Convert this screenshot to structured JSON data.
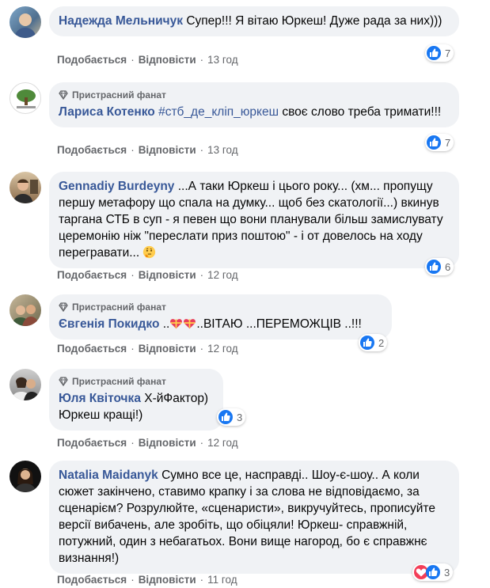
{
  "ui": {
    "like": "Подобається",
    "reply": "Відповісти",
    "fan_badge": "Пристрасний фанат",
    "sep": "·"
  },
  "comments": [
    {
      "author": "Надежда Мельничук",
      "text": "Супер!!! Я вітаю Юркеш! Дуже рада за них)))",
      "time": "13 год",
      "reactions": "7"
    },
    {
      "author": "Лариса Котенко",
      "hashtag": "#стб_де_кліп_юркеш",
      "text": "своє слово треба тримати!!!",
      "time": "13 год",
      "reactions": "7"
    },
    {
      "author": "Gennadiy Burdeyny",
      "text": "...А таки Юркеш і цього року... (хм... пропущу першу метафору що спала на думку... щоб без скатології...) вкинув таргана СТБ в суп - я певен що вони планували більш замислувату церемонію ніж \"переслати приз поштою\" - і от довелось на ходу перегравати...",
      "time": "12 год",
      "reactions": "6"
    },
    {
      "author": "Євгенія Покидко",
      "text_a": "..",
      "text_b": "..ВІТАЮ ...ПЕРЕМОЖЦІВ ..!!!",
      "time": "12 год",
      "reactions": "2"
    },
    {
      "author": "Юля Квіточка",
      "text": "Х-йФактор) Юркеш кращі!)",
      "time": "12 год",
      "reactions": "3"
    },
    {
      "author": "Natalia Maidanyk",
      "text": "Сумно все це, насправді.. Шоу-є-шоу.. А коли сюжет закінчено, ставимо крапку і за слова не відповідаємо, за сценарієм? Розрулюйте, «сценаристи», викручуйтесь, прописуйте версії вибачень, але зробіть, що обіцяли! Юркеш- справжній, потужний, один з небагатьох. Вони вище нагород, бо є справжнє визнання!)",
      "time": "11 год",
      "reactions": "3"
    }
  ],
  "colors": {
    "link": "#385898",
    "bubble": "#f0f2f5",
    "like": "#1877f2",
    "love": "#f33e58"
  }
}
